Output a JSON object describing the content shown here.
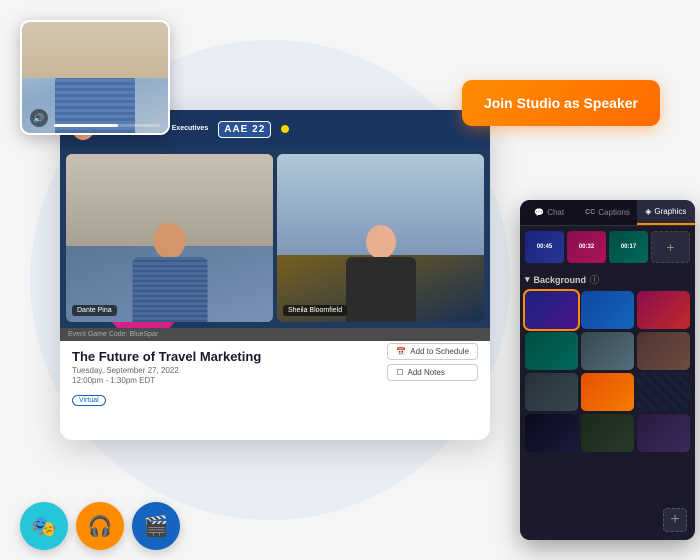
{
  "bg_circle": {},
  "speaker_cam": {
    "audio_icon": "🔊"
  },
  "join_button": {
    "label": "Join Studio as Speaker"
  },
  "studio_window": {
    "header": {
      "org_name": "Association of\nAirline Executives",
      "badge": "AAE 22"
    },
    "video": {
      "speaker1": {
        "name": "Dante Pina"
      },
      "speaker2": {
        "name": "Sheila Bloomfield"
      }
    },
    "event_code_bar": "Event Game Code: BlueSpar",
    "info": {
      "title": "The Future of Travel Marketing",
      "date": "Tuesday, September 27, 2022",
      "time": "12:00pm - 1:30pm EDT",
      "tag": "Virtual",
      "btn_schedule": "Add to Schedule",
      "btn_notes": "Add Notes"
    }
  },
  "right_panel": {
    "tabs": [
      {
        "label": "Chat",
        "icon": "💬",
        "active": false
      },
      {
        "label": "Captions",
        "icon": "CC",
        "active": false
      },
      {
        "label": "Graphics",
        "icon": "◈",
        "active": true
      }
    ],
    "thumbnails": [
      {
        "type": "timer",
        "value": "00:45"
      },
      {
        "type": "timer",
        "value": "00:32"
      },
      {
        "type": "timer",
        "value": "00:17"
      },
      {
        "type": "add"
      }
    ],
    "bg_section": {
      "title": "Background",
      "items": [
        "bg1",
        "bg2",
        "bg3",
        "bg4",
        "bg5",
        "bg6",
        "bg7",
        "bg8",
        "bg9",
        "bg10",
        "bg11",
        "bg12"
      ],
      "add_label": "+"
    }
  },
  "bottom_toolbar": {
    "btn1": {
      "icon": "🎭",
      "label": "avatar"
    },
    "btn2": {
      "icon": "🎧",
      "label": "support"
    },
    "btn3": {
      "icon": "🎬",
      "label": "camera"
    }
  }
}
